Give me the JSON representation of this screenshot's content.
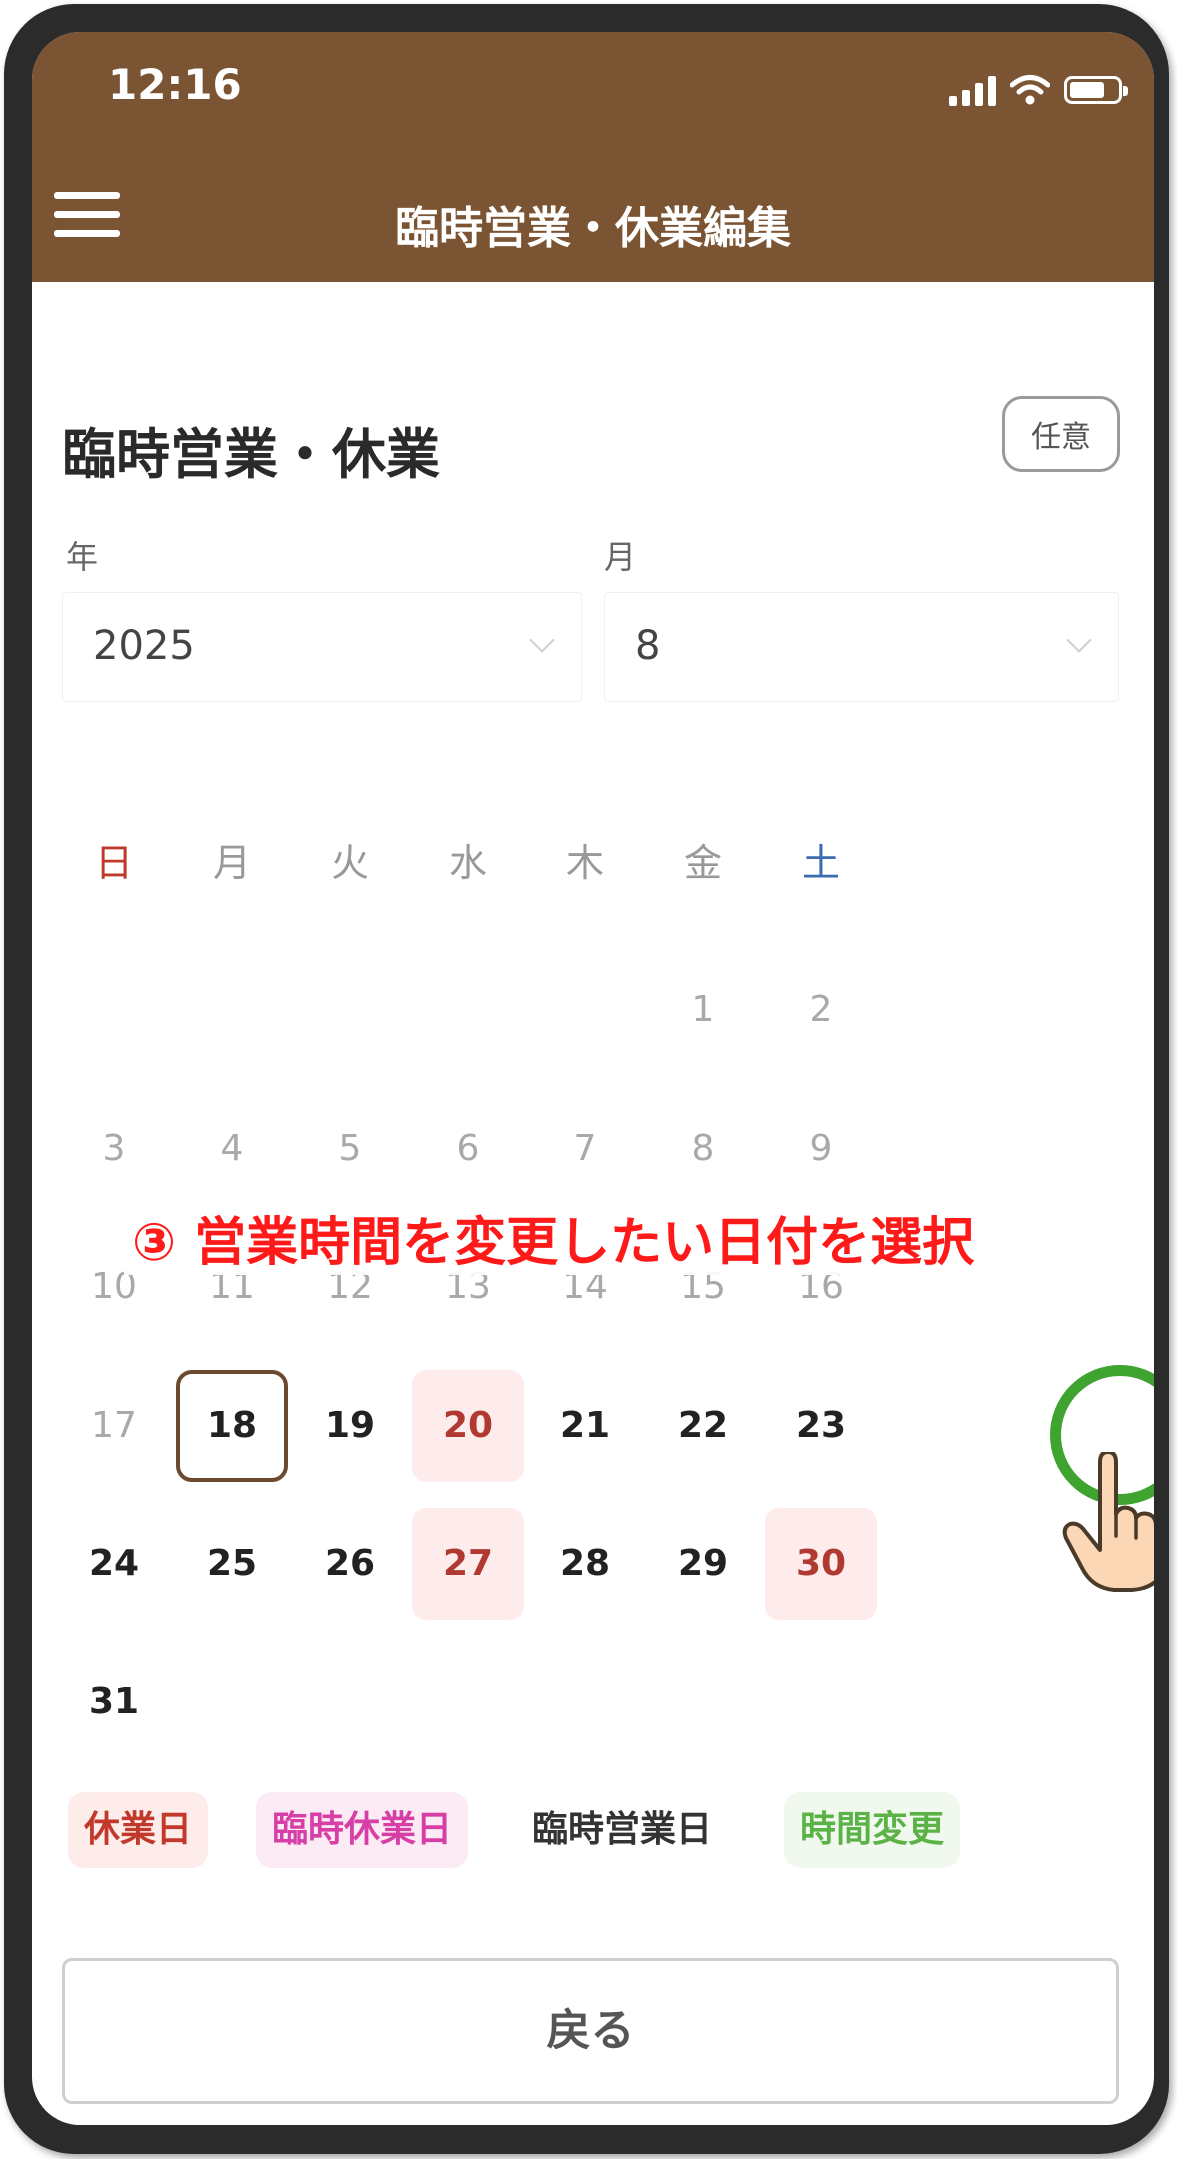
{
  "status_bar": {
    "time": "12:16"
  },
  "app_bar": {
    "title": "臨時営業・休業編集"
  },
  "section": {
    "title": "臨時営業・休業",
    "badge": "任意"
  },
  "fields": {
    "year": {
      "label": "年",
      "value": "2025"
    },
    "month": {
      "label": "月",
      "value": "8"
    }
  },
  "calendar": {
    "weekdays": [
      "日",
      "月",
      "火",
      "水",
      "木",
      "金",
      "土"
    ],
    "weekday_colors": [
      "#c0392b",
      "#999999",
      "#999999",
      "#999999",
      "#999999",
      "#999999",
      "#3a6cb0"
    ],
    "weeks": [
      [
        "",
        "",
        "",
        "",
        "",
        "1",
        "2"
      ],
      [
        "3",
        "4",
        "5",
        "6",
        "7",
        "8",
        "9"
      ],
      [
        "10",
        "11",
        "12",
        "13",
        "14",
        "15",
        "16"
      ],
      [
        "17",
        "18",
        "19",
        "20",
        "21",
        "22",
        "23"
      ],
      [
        "24",
        "25",
        "26",
        "27",
        "28",
        "29",
        "30"
      ],
      [
        "31",
        "",
        "",
        "",
        "",
        "",
        ""
      ]
    ],
    "today": "18",
    "holidays": [
      "20",
      "27",
      "30"
    ]
  },
  "annotation": {
    "text": "③ 営業時間を変更したい日付を選択"
  },
  "legend": [
    {
      "label": "休業日",
      "color": "#c0392b",
      "bg": "#fdecea"
    },
    {
      "label": "臨時休業日",
      "color": "#d63fa6",
      "bg": "#fcebf5"
    },
    {
      "label": "臨時営業日",
      "color": "#333333",
      "bg": "#ffffff"
    },
    {
      "label": "時間変更",
      "color": "#5bb246",
      "bg": "#f1f9ee"
    }
  ],
  "buttons": {
    "back": "戻る"
  },
  "colors": {
    "app_bar": "#7b5433",
    "annotation": "#ff1a1a",
    "tap_ring": "#3ea32f"
  }
}
